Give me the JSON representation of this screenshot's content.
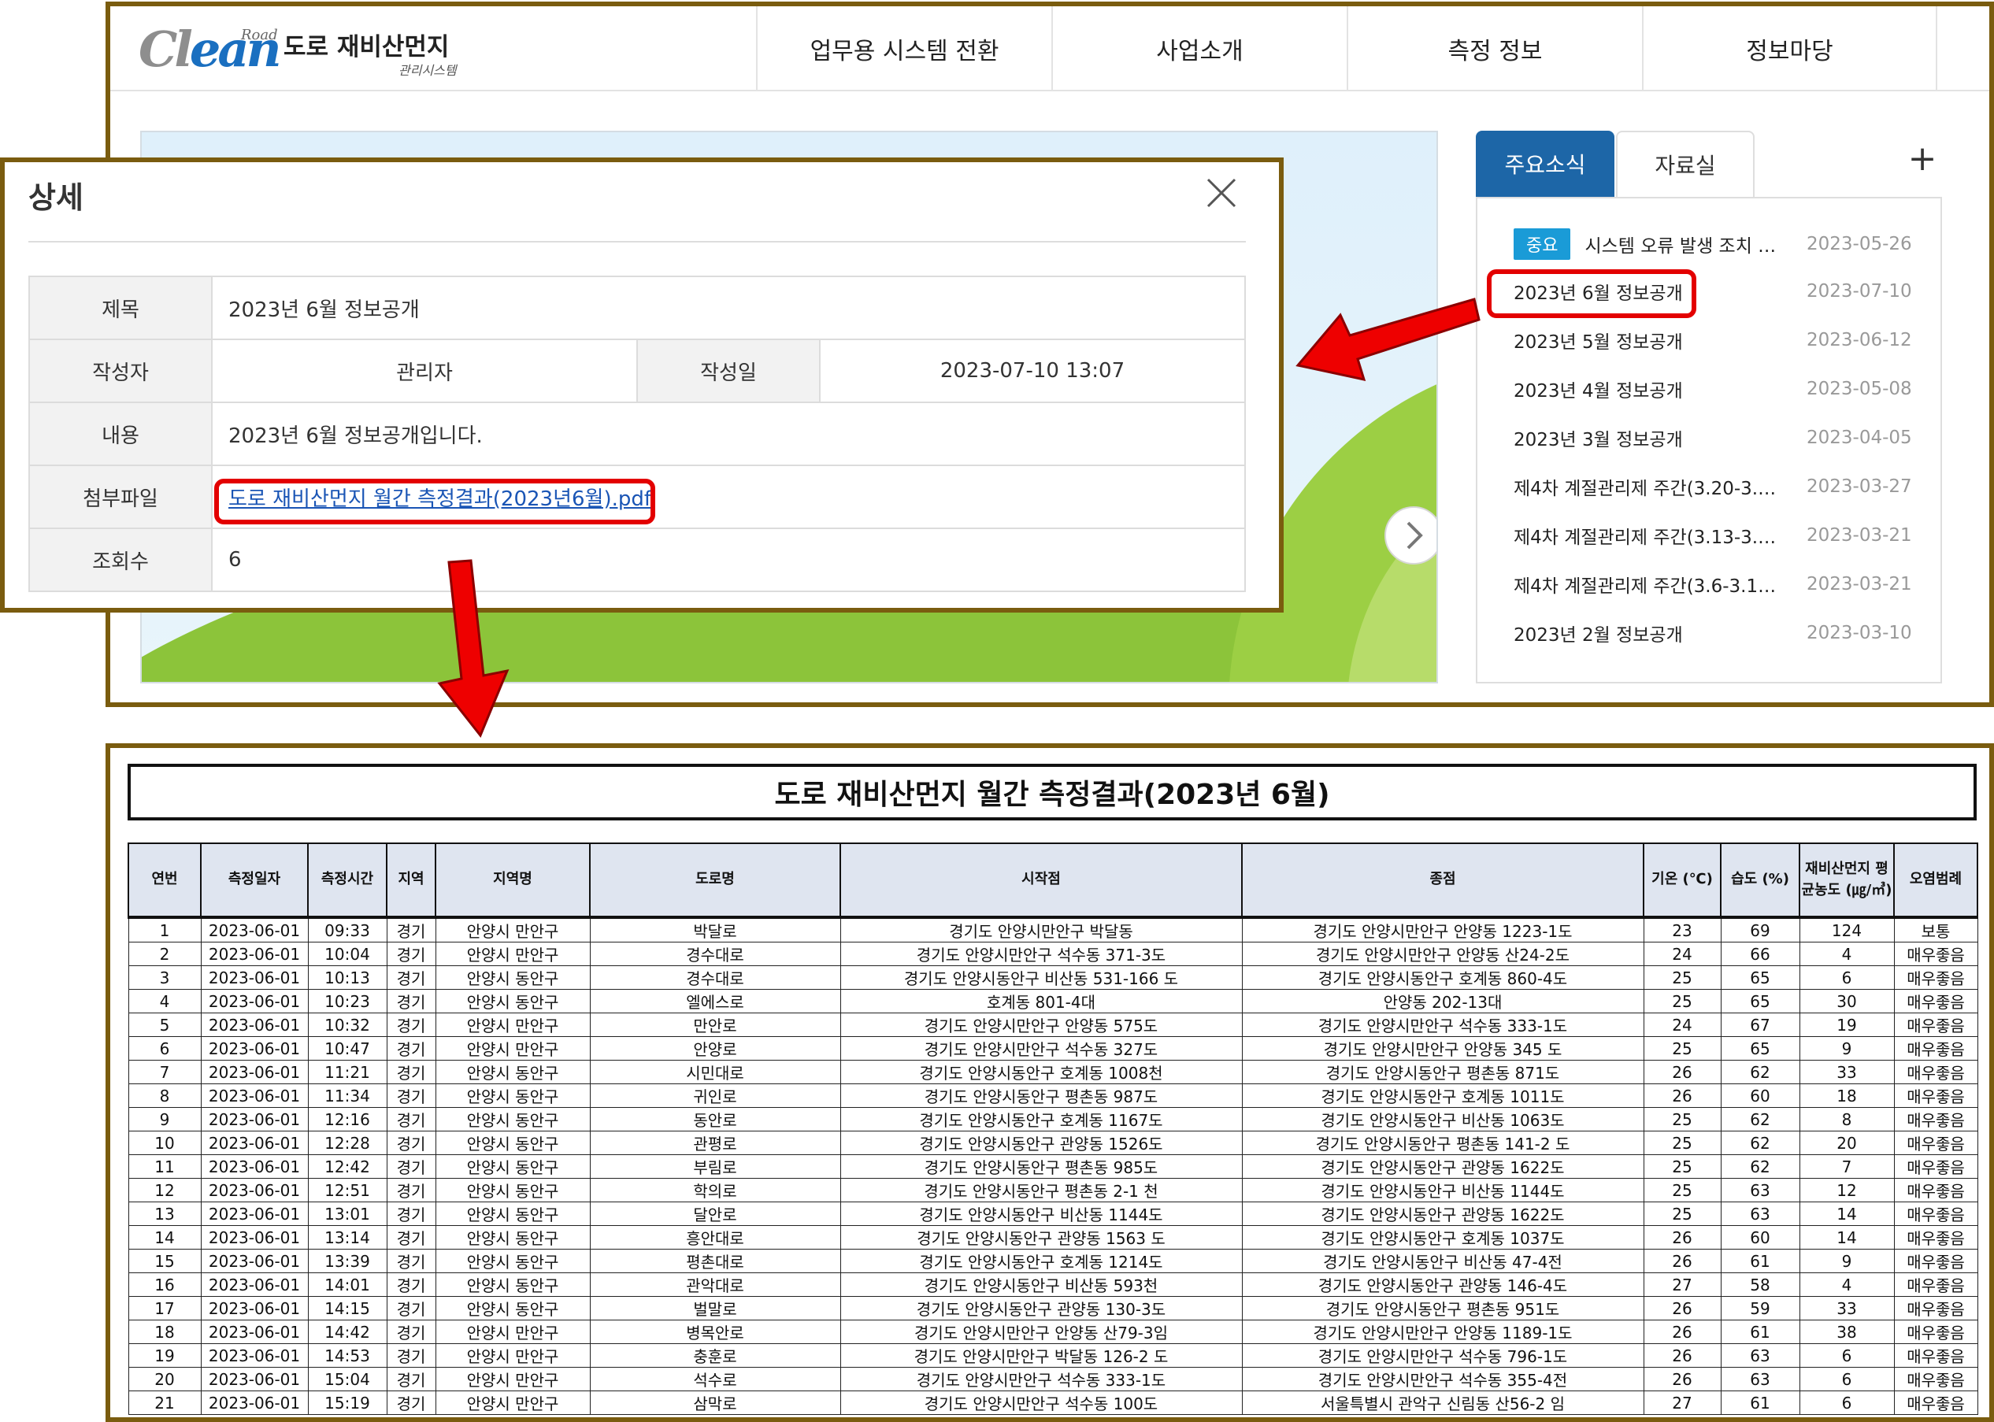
{
  "site": {
    "logo_road": "Road",
    "logo_clean_a": "Cl",
    "logo_clean_b": "ean",
    "title": "도로 재비산먼지",
    "subtitle": "관리시스템",
    "menu": [
      "업무용 시스템 전환",
      "사업소개",
      "측정 정보",
      "정보마당"
    ]
  },
  "notices": {
    "tabs": [
      "주요소식",
      "자료실"
    ],
    "plus": "+",
    "badge": "중요",
    "items": [
      {
        "title": "시스템 오류 발생 조치 …",
        "date": "2023-05-26"
      },
      {
        "title": "2023년 6월 정보공개",
        "date": "2023-07-10"
      },
      {
        "title": "2023년 5월 정보공개",
        "date": "2023-06-12"
      },
      {
        "title": "2023년 4월 정보공개",
        "date": "2023-05-08"
      },
      {
        "title": "2023년 3월 정보공개",
        "date": "2023-04-05"
      },
      {
        "title": "제4차 계절관리제 주간(3.20-3.2…",
        "date": "2023-03-27"
      },
      {
        "title": "제4차 계절관리제 주간(3.13-3.1…",
        "date": "2023-03-21"
      },
      {
        "title": "제4차 계절관리제 주간(3.6-3.10)…",
        "date": "2023-03-21"
      },
      {
        "title": "2023년 2월 정보공개",
        "date": "2023-03-10"
      }
    ]
  },
  "modal": {
    "title": "상세",
    "labels": {
      "subject": "제목",
      "author": "작성자",
      "date": "작성일",
      "content": "내용",
      "attachment": "첨부파일",
      "views": "조회수"
    },
    "subject": "2023년 6월 정보공개",
    "author": "관리자",
    "date": "2023-07-10 13:07",
    "content": "2023년 6월 정보공개입니다.",
    "attachment": "도로 재비산먼지 월간 측정결과(2023년6월).pdf",
    "views": "6"
  },
  "document": {
    "title": "도로 재비산먼지 월간 측정결과(2023년 6월)",
    "headers": [
      "연번",
      "측정일자",
      "측정시간",
      "지역",
      "지역명",
      "도로명",
      "시작점",
      "종점",
      "기온 (℃)",
      "습도 (%)",
      "재비산먼지 평균농도 (㎍/㎥)",
      "오염범례"
    ],
    "rows": [
      [
        "1",
        "2023-06-01",
        "09:33",
        "경기",
        "안양시 만안구",
        "박달로",
        "경기도 안양시만안구 박달동",
        "경기도 안양시만안구 안양동 1223-1도",
        "23",
        "69",
        "124",
        "보통"
      ],
      [
        "2",
        "2023-06-01",
        "10:04",
        "경기",
        "안양시 만안구",
        "경수대로",
        "경기도 안양시만안구 석수동 371-3도",
        "경기도 안양시만안구 안양동 산24-2도",
        "24",
        "66",
        "4",
        "매우좋음"
      ],
      [
        "3",
        "2023-06-01",
        "10:13",
        "경기",
        "안양시 동안구",
        "경수대로",
        "경기도 안양시동안구 비산동 531-166 도",
        "경기도 안양시동안구 호계동 860-4도",
        "25",
        "65",
        "6",
        "매우좋음"
      ],
      [
        "4",
        "2023-06-01",
        "10:23",
        "경기",
        "안양시 동안구",
        "엘에스로",
        "호계동 801-4대",
        "안양동 202-13대",
        "25",
        "65",
        "30",
        "매우좋음"
      ],
      [
        "5",
        "2023-06-01",
        "10:32",
        "경기",
        "안양시 만안구",
        "만안로",
        "경기도 안양시만안구 안양동 575도",
        "경기도 안양시만안구 석수동 333-1도",
        "24",
        "67",
        "19",
        "매우좋음"
      ],
      [
        "6",
        "2023-06-01",
        "10:47",
        "경기",
        "안양시 만안구",
        "안양로",
        "경기도 안양시만안구 석수동 327도",
        "경기도 안양시만안구 안양동 345 도",
        "25",
        "65",
        "9",
        "매우좋음"
      ],
      [
        "7",
        "2023-06-01",
        "11:21",
        "경기",
        "안양시 동안구",
        "시민대로",
        "경기도 안양시동안구 호계동 1008천",
        "경기도 안양시동안구 평촌동 871도",
        "26",
        "62",
        "33",
        "매우좋음"
      ],
      [
        "8",
        "2023-06-01",
        "11:34",
        "경기",
        "안양시 동안구",
        "귀인로",
        "경기도 안양시동안구 평촌동 987도",
        "경기도 안양시동안구 호계동 1011도",
        "26",
        "60",
        "18",
        "매우좋음"
      ],
      [
        "9",
        "2023-06-01",
        "12:16",
        "경기",
        "안양시 동안구",
        "동안로",
        "경기도 안양시동안구 호계동 1167도",
        "경기도 안양시동안구 비산동 1063도",
        "25",
        "62",
        "8",
        "매우좋음"
      ],
      [
        "10",
        "2023-06-01",
        "12:28",
        "경기",
        "안양시 동안구",
        "관평로",
        "경기도 안양시동안구 관양동 1526도",
        "경기도 안양시동안구 평촌동 141-2 도",
        "25",
        "62",
        "20",
        "매우좋음"
      ],
      [
        "11",
        "2023-06-01",
        "12:42",
        "경기",
        "안양시 동안구",
        "부림로",
        "경기도 안양시동안구 평촌동 985도",
        "경기도 안양시동안구 관양동 1622도",
        "25",
        "62",
        "7",
        "매우좋음"
      ],
      [
        "12",
        "2023-06-01",
        "12:51",
        "경기",
        "안양시 동안구",
        "학의로",
        "경기도 안양시동안구 평촌동 2-1 천",
        "경기도 안양시동안구 비산동 1144도",
        "25",
        "63",
        "12",
        "매우좋음"
      ],
      [
        "13",
        "2023-06-01",
        "13:01",
        "경기",
        "안양시 동안구",
        "달안로",
        "경기도 안양시동안구 비산동 1144도",
        "경기도 안양시동안구 관양동 1622도",
        "25",
        "63",
        "14",
        "매우좋음"
      ],
      [
        "14",
        "2023-06-01",
        "13:14",
        "경기",
        "안양시 동안구",
        "흥안대로",
        "경기도 안양시동안구 관양동 1563 도",
        "경기도 안양시동안구 호계동 1037도",
        "26",
        "60",
        "14",
        "매우좋음"
      ],
      [
        "15",
        "2023-06-01",
        "13:39",
        "경기",
        "안양시 동안구",
        "평촌대로",
        "경기도 안양시동안구 호계동 1214도",
        "경기도 안양시동안구 비산동 47-4전",
        "26",
        "61",
        "9",
        "매우좋음"
      ],
      [
        "16",
        "2023-06-01",
        "14:01",
        "경기",
        "안양시 동안구",
        "관악대로",
        "경기도 안양시동안구 비산동 593천",
        "경기도 안양시동안구 관양동 146-4도",
        "27",
        "58",
        "4",
        "매우좋음"
      ],
      [
        "17",
        "2023-06-01",
        "14:15",
        "경기",
        "안양시 동안구",
        "벌말로",
        "경기도 안양시동안구 관양동 130-3도",
        "경기도 안양시동안구 평촌동 951도",
        "26",
        "59",
        "33",
        "매우좋음"
      ],
      [
        "18",
        "2023-06-01",
        "14:42",
        "경기",
        "안양시 만안구",
        "병목안로",
        "경기도 안양시만안구 안양동 산79-3임",
        "경기도 안양시만안구 안양동 1189-1도",
        "26",
        "61",
        "38",
        "매우좋음"
      ],
      [
        "19",
        "2023-06-01",
        "14:53",
        "경기",
        "안양시 만안구",
        "충훈로",
        "경기도 안양시만안구 박달동 126-2 도",
        "경기도 안양시만안구 석수동 796-1도",
        "26",
        "63",
        "6",
        "매우좋음"
      ],
      [
        "20",
        "2023-06-01",
        "15:04",
        "경기",
        "안양시 만안구",
        "석수로",
        "경기도 안양시만안구 석수동 333-1도",
        "경기도 안양시만안구 석수동 355-4전",
        "26",
        "63",
        "6",
        "매우좋음"
      ],
      [
        "21",
        "2023-06-01",
        "15:19",
        "경기",
        "안양시 만안구",
        "삼막로",
        "경기도 안양시만안구 석수동 100도",
        "서울특별시 관악구 신림동 산56-2 임",
        "27",
        "61",
        "6",
        "매우좋음"
      ]
    ]
  },
  "colors": {
    "highlight": "#e30000",
    "frame": "#7a5c0f",
    "tab_active": "#1d66a7",
    "badge": "#1a9bd7",
    "link": "#1a55b5"
  }
}
